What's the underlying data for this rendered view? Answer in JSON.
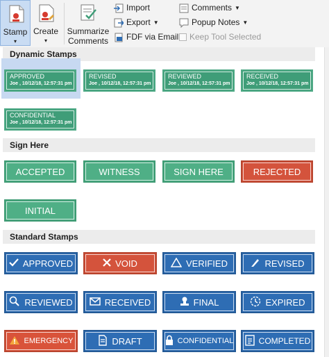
{
  "ribbon": {
    "stamp_label": "Stamp",
    "create_label": "Create",
    "summarize_line1": "Summarize",
    "summarize_line2": "Comments",
    "import_label": "Import",
    "export_label": "Export",
    "fdf_label": "FDF via Email",
    "comments_label": "Comments",
    "popup_label": "Popup Notes",
    "keep_label": "Keep Tool Selected"
  },
  "sections": {
    "dynamic": "Dynamic Stamps",
    "sign": "Sign Here",
    "standard": "Standard Stamps"
  },
  "dynamic_stamps": [
    {
      "title": "APPROVED",
      "sub": "Joe , 10/12/18, 12:57:31 pm"
    },
    {
      "title": "REVISED",
      "sub": "Joe , 10/12/18, 12:57:31 pm"
    },
    {
      "title": "REVIEWED",
      "sub": "Joe , 10/12/18, 12:57:31 pm"
    },
    {
      "title": "RECEIVED",
      "sub": "Joe , 10/12/18, 12:57:31 pm"
    },
    {
      "title": "CONFIDENTIAL",
      "sub": "Joe , 10/12/18, 12:57:31 pm"
    }
  ],
  "sign_stamps": [
    "ACCEPTED",
    "WITNESS",
    "SIGN HERE",
    "REJECTED",
    "INITIAL"
  ],
  "standard_stamps": [
    {
      "label": "APPROVED",
      "icon": "check-icon"
    },
    {
      "label": "VOID",
      "icon": "x-icon"
    },
    {
      "label": "VERIFIED",
      "icon": "warning-triangle-icon"
    },
    {
      "label": "REVISED",
      "icon": "pencil-icon"
    },
    {
      "label": "REVIEWED",
      "icon": "magnifier-icon"
    },
    {
      "label": "RECEIVED",
      "icon": "envelope-icon"
    },
    {
      "label": "FINAL",
      "icon": "stamp-icon"
    },
    {
      "label": "EXPIRED",
      "icon": "clock-icon"
    },
    {
      "label": "EMERGENCY",
      "icon": "warning-icon"
    },
    {
      "label": "DRAFT",
      "icon": "document-icon"
    },
    {
      "label": "CONFIDENTIAL",
      "icon": "lock-icon"
    },
    {
      "label": "COMPLETED",
      "icon": "checklist-icon"
    }
  ],
  "colors": {
    "green": "#4faf86",
    "red": "#d4533c",
    "blue": "#2e6db4",
    "selection": "#c7d9f1"
  }
}
